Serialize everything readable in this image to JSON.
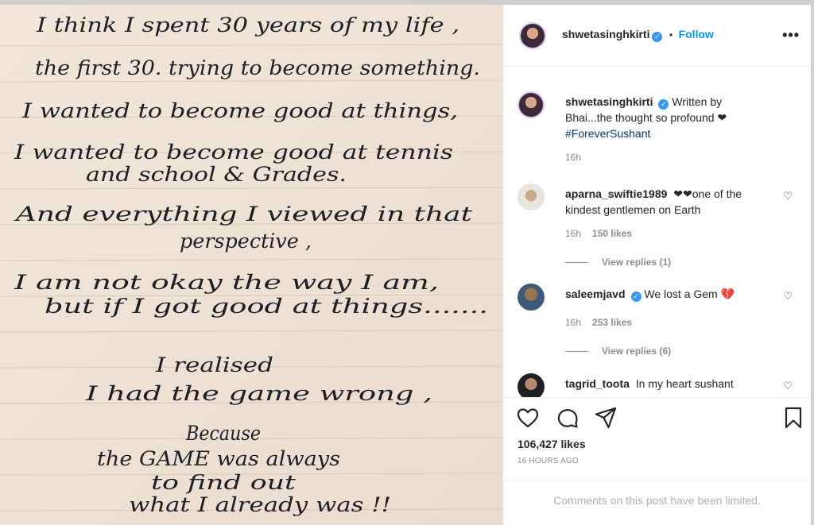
{
  "post_image": {
    "lines": [
      "I think I spent 30 years of my life ,",
      "the first 30. trying to become something.",
      "I wanted to become good at things,",
      "I wanted to become good at tennis",
      "and school & Grades.",
      "And everything I viewed in that",
      "perspective ,",
      "I am not okay the way I am,",
      "but if I got good at things.......",
      "I realised",
      "I had the game wrong ,",
      "Because",
      "the GAME was always",
      "to find out",
      "what I already was !!"
    ]
  },
  "header": {
    "username": "shwetasinghkirti",
    "separator": "•",
    "follow_label": "Follow",
    "more_icon": "more-options-icon"
  },
  "caption": {
    "username": "shwetasinghkirti",
    "text": "Written by Bhai...the thought so profound ❤",
    "hashtag": "#ForeverSushant",
    "time": "16h"
  },
  "comments": [
    {
      "username": "aparna_swiftie1989",
      "text": "❤❤one of the kindest gentlemen on Earth",
      "time": "16h",
      "likes": "150 likes",
      "replies": "View replies (1)"
    },
    {
      "username": "saleemjavd",
      "verified": true,
      "text": "We lost a Gem 💔",
      "time": "16h",
      "likes": "253 likes",
      "replies": "View replies (6)"
    },
    {
      "username": "tagrid_toota",
      "text": "In my heart sushant"
    }
  ],
  "actions": {
    "likes": "106,427 likes",
    "timestamp": "16 HOURS AGO"
  },
  "footer": {
    "limited_text": "Comments on this post have been limited."
  },
  "colors": {
    "accent": "#0095f6",
    "verified": "#3897f0",
    "paper": "#efe2d6",
    "ink": "#1e1e26"
  }
}
